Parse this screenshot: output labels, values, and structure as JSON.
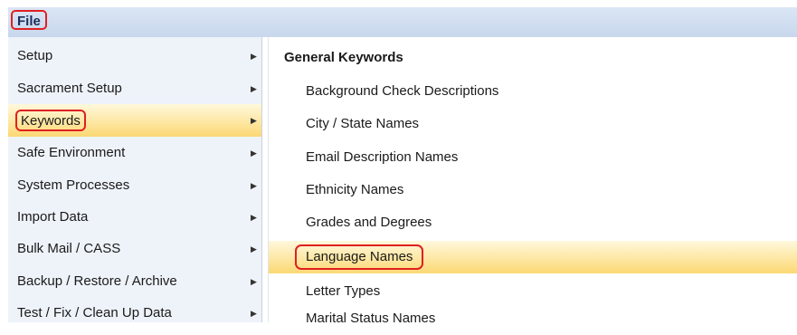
{
  "menubar": {
    "file_label": "File"
  },
  "left_menu": {
    "items": [
      {
        "label": "Setup"
      },
      {
        "label": "Sacrament Setup"
      },
      {
        "label": "Keywords"
      },
      {
        "label": "Safe Environment"
      },
      {
        "label": "System Processes"
      },
      {
        "label": "Import Data"
      },
      {
        "label": "Bulk Mail / CASS"
      },
      {
        "label": "Backup / Restore / Archive"
      },
      {
        "label": "Test / Fix / Clean Up Data"
      }
    ],
    "submenu_arrow": "▶"
  },
  "right_menu": {
    "header": "General Keywords",
    "items": [
      {
        "label": "Background Check Descriptions"
      },
      {
        "label": "City / State Names"
      },
      {
        "label": "Email Description Names"
      },
      {
        "label": "Ethnicity Names"
      },
      {
        "label": "Grades and Degrees"
      },
      {
        "label": "Language Names"
      },
      {
        "label": "Letter Types"
      },
      {
        "label": "Marital Status Names"
      }
    ]
  },
  "colors": {
    "highlight": "#fcd874",
    "annotation": "#e02020",
    "menubar": "#c8d7ec"
  }
}
